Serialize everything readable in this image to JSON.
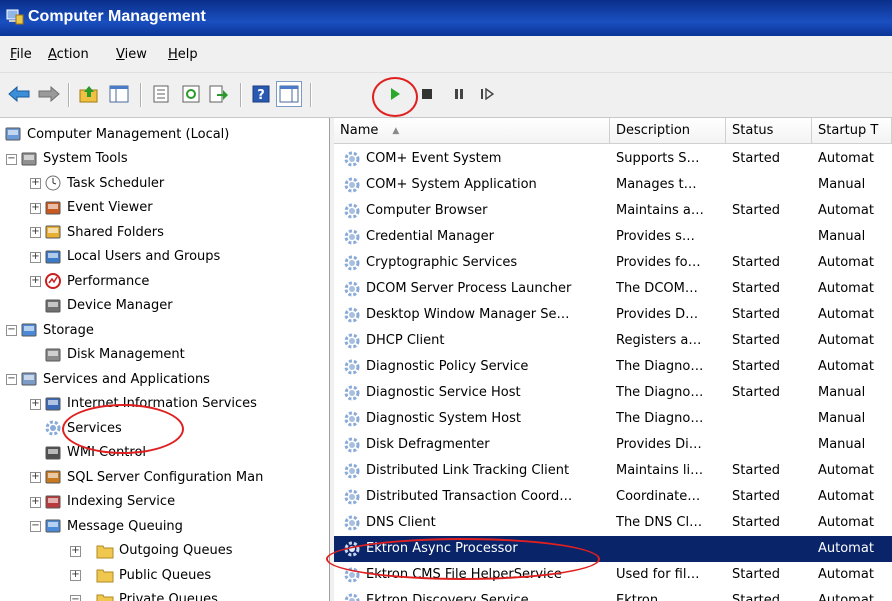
{
  "window": {
    "title": "Computer Management"
  },
  "menu": [
    {
      "label": "File",
      "ul": "F",
      "rest": "ile"
    },
    {
      "label": "Action",
      "ul": "A",
      "rest": "ction"
    },
    {
      "label": "View",
      "ul": "V",
      "rest": "iew"
    },
    {
      "label": "Help",
      "ul": "H",
      "rest": "elp"
    }
  ],
  "toolbar": {
    "buttons": [
      "back-icon",
      "forward-icon",
      "up-folder-icon",
      "show-hide-tree-icon",
      "properties-icon",
      "refresh-icon",
      "export-icon",
      "help-icon",
      "show-hide-action-icon",
      "start-service-icon",
      "stop-service-icon",
      "pause-service-icon",
      "resume-service-icon"
    ]
  },
  "tree": [
    {
      "label": "Computer Management (Local)",
      "level": 0,
      "expander": "",
      "icon": "computer-icon"
    },
    {
      "label": "System Tools",
      "level": 1,
      "expander": "−",
      "icon": "tools-icon"
    },
    {
      "label": "Task Scheduler",
      "level": 2,
      "expander": "+",
      "icon": "clock-icon"
    },
    {
      "label": "Event Viewer",
      "level": 2,
      "expander": "+",
      "icon": "event-viewer-icon"
    },
    {
      "label": "Shared Folders",
      "level": 2,
      "expander": "+",
      "icon": "shared-folders-icon"
    },
    {
      "label": "Local Users and Groups",
      "level": 2,
      "expander": "+",
      "icon": "users-icon"
    },
    {
      "label": "Performance",
      "level": 2,
      "expander": "+",
      "icon": "performance-icon"
    },
    {
      "label": "Device Manager",
      "level": 2,
      "expander": "",
      "icon": "device-manager-icon"
    },
    {
      "label": "Storage",
      "level": 1,
      "expander": "−",
      "icon": "storage-icon"
    },
    {
      "label": "Disk Management",
      "level": 2,
      "expander": "",
      "icon": "disk-icon"
    },
    {
      "label": "Services and Applications",
      "level": 1,
      "expander": "−",
      "icon": "services-apps-icon"
    },
    {
      "label": "Internet Information Services",
      "level": 2,
      "expander": "+",
      "icon": "iis-icon"
    },
    {
      "label": "Services",
      "level": 2,
      "expander": "",
      "icon": "gear-icon"
    },
    {
      "label": "WMI Control",
      "level": 2,
      "expander": "",
      "icon": "wmi-icon"
    },
    {
      "label": "SQL Server Configuration Man",
      "level": 2,
      "expander": "+",
      "icon": "sql-icon"
    },
    {
      "label": "Indexing Service",
      "level": 2,
      "expander": "+",
      "icon": "indexing-icon"
    },
    {
      "label": "Message Queuing",
      "level": 2,
      "expander": "−",
      "icon": "message-queuing-icon"
    },
    {
      "label": "Outgoing Queues",
      "level": 3,
      "expander": "+",
      "icon": "folder-icon"
    },
    {
      "label": "Public Queues",
      "level": 3,
      "expander": "+",
      "icon": "folder-icon"
    },
    {
      "label": "Private Queues",
      "level": 3,
      "expander": "−",
      "icon": "folder-icon"
    }
  ],
  "columns": [
    {
      "label": "Name",
      "sort": "▲"
    },
    {
      "label": "Description",
      "sort": ""
    },
    {
      "label": "Status",
      "sort": ""
    },
    {
      "label": "Startup T",
      "sort": ""
    }
  ],
  "services": [
    {
      "name": "COM+ Event System",
      "description": "Supports S…",
      "status": "Started",
      "startup": "Automat"
    },
    {
      "name": "COM+ System Application",
      "description": "Manages t…",
      "status": "",
      "startup": "Manual"
    },
    {
      "name": "Computer Browser",
      "description": "Maintains a…",
      "status": "Started",
      "startup": "Automat"
    },
    {
      "name": "Credential Manager",
      "description": "Provides s…",
      "status": "",
      "startup": "Manual"
    },
    {
      "name": "Cryptographic Services",
      "description": "Provides fo…",
      "status": "Started",
      "startup": "Automat"
    },
    {
      "name": "DCOM Server Process Launcher",
      "description": "The DCOM…",
      "status": "Started",
      "startup": "Automat"
    },
    {
      "name": "Desktop Window Manager Se…",
      "description": "Provides D…",
      "status": "Started",
      "startup": "Automat"
    },
    {
      "name": "DHCP Client",
      "description": "Registers a…",
      "status": "Started",
      "startup": "Automat"
    },
    {
      "name": "Diagnostic Policy Service",
      "description": "The Diagno…",
      "status": "Started",
      "startup": "Automat"
    },
    {
      "name": "Diagnostic Service Host",
      "description": "The Diagno…",
      "status": "Started",
      "startup": "Manual"
    },
    {
      "name": "Diagnostic System Host",
      "description": "The Diagno…",
      "status": "",
      "startup": "Manual"
    },
    {
      "name": "Disk Defragmenter",
      "description": "Provides Di…",
      "status": "",
      "startup": "Manual"
    },
    {
      "name": "Distributed Link Tracking Client",
      "description": "Maintains li…",
      "status": "Started",
      "startup": "Automat"
    },
    {
      "name": "Distributed Transaction Coord…",
      "description": "Coordinate…",
      "status": "Started",
      "startup": "Automat"
    },
    {
      "name": "DNS Client",
      "description": "The DNS Cl…",
      "status": "Started",
      "startup": "Automat"
    },
    {
      "name": "Ektron Async Processor",
      "description": "",
      "status": "",
      "startup": "Automat",
      "selected": true
    },
    {
      "name": "Ektron CMS File HelperService",
      "description": "Used for fil…",
      "status": "Started",
      "startup": "Automat"
    },
    {
      "name": "Ektron Discovery Service",
      "description": "Ektron…",
      "status": "Started",
      "startup": "Automat"
    }
  ]
}
